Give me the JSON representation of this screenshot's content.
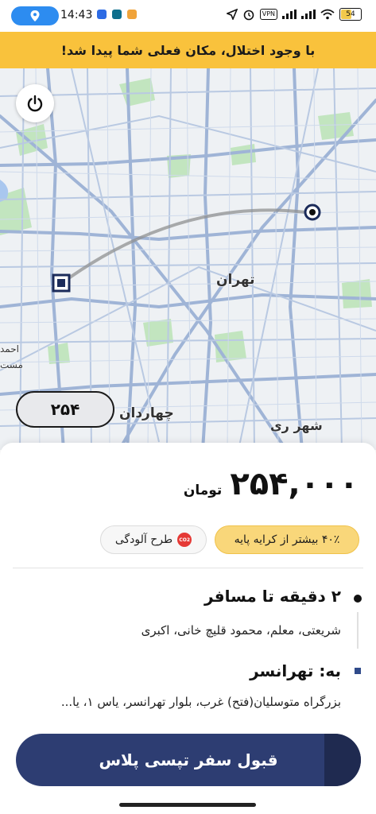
{
  "status_bar": {
    "time": "14:43",
    "vpn": "VPN",
    "battery": "54",
    "battery_level": 0.54
  },
  "banner": {
    "text": "با وجود اختلال، مکان فعلی شما پیدا شد!"
  },
  "map": {
    "labels": {
      "tehran": "تهران",
      "chahardangeh": "چهاردان",
      "shahr_rey": "شهر ری",
      "ahmad": "احمد",
      "mosta": "مست"
    },
    "fare_pill": "۲۵۴"
  },
  "trip": {
    "price": "۲۵۴,۰۰۰",
    "currency": "تومان",
    "surge_chip": "۴۰٪ بیشتر از کرایه پایه",
    "pollution_chip": "طرح آلودگی",
    "co2": "CO2",
    "pickup_eta": "۲ دقیقه تا مسافر",
    "pickup_address": "شریعتی، معلم، محمود قلیچ خانی، اکبری",
    "dropoff_title": "به: تهرانسر",
    "dropoff_address": "بزرگراه متوسلیان(فتح) غرب، بلوار تهرانسر، یاس ۱، یا..."
  },
  "accept_button": {
    "label": "قبول سفر تپسی پلاس"
  },
  "colors": {
    "banner": "#f9c23c",
    "accept": "#2d3d72",
    "surge_chip": "#f9d77a",
    "co2": "#e53935"
  }
}
